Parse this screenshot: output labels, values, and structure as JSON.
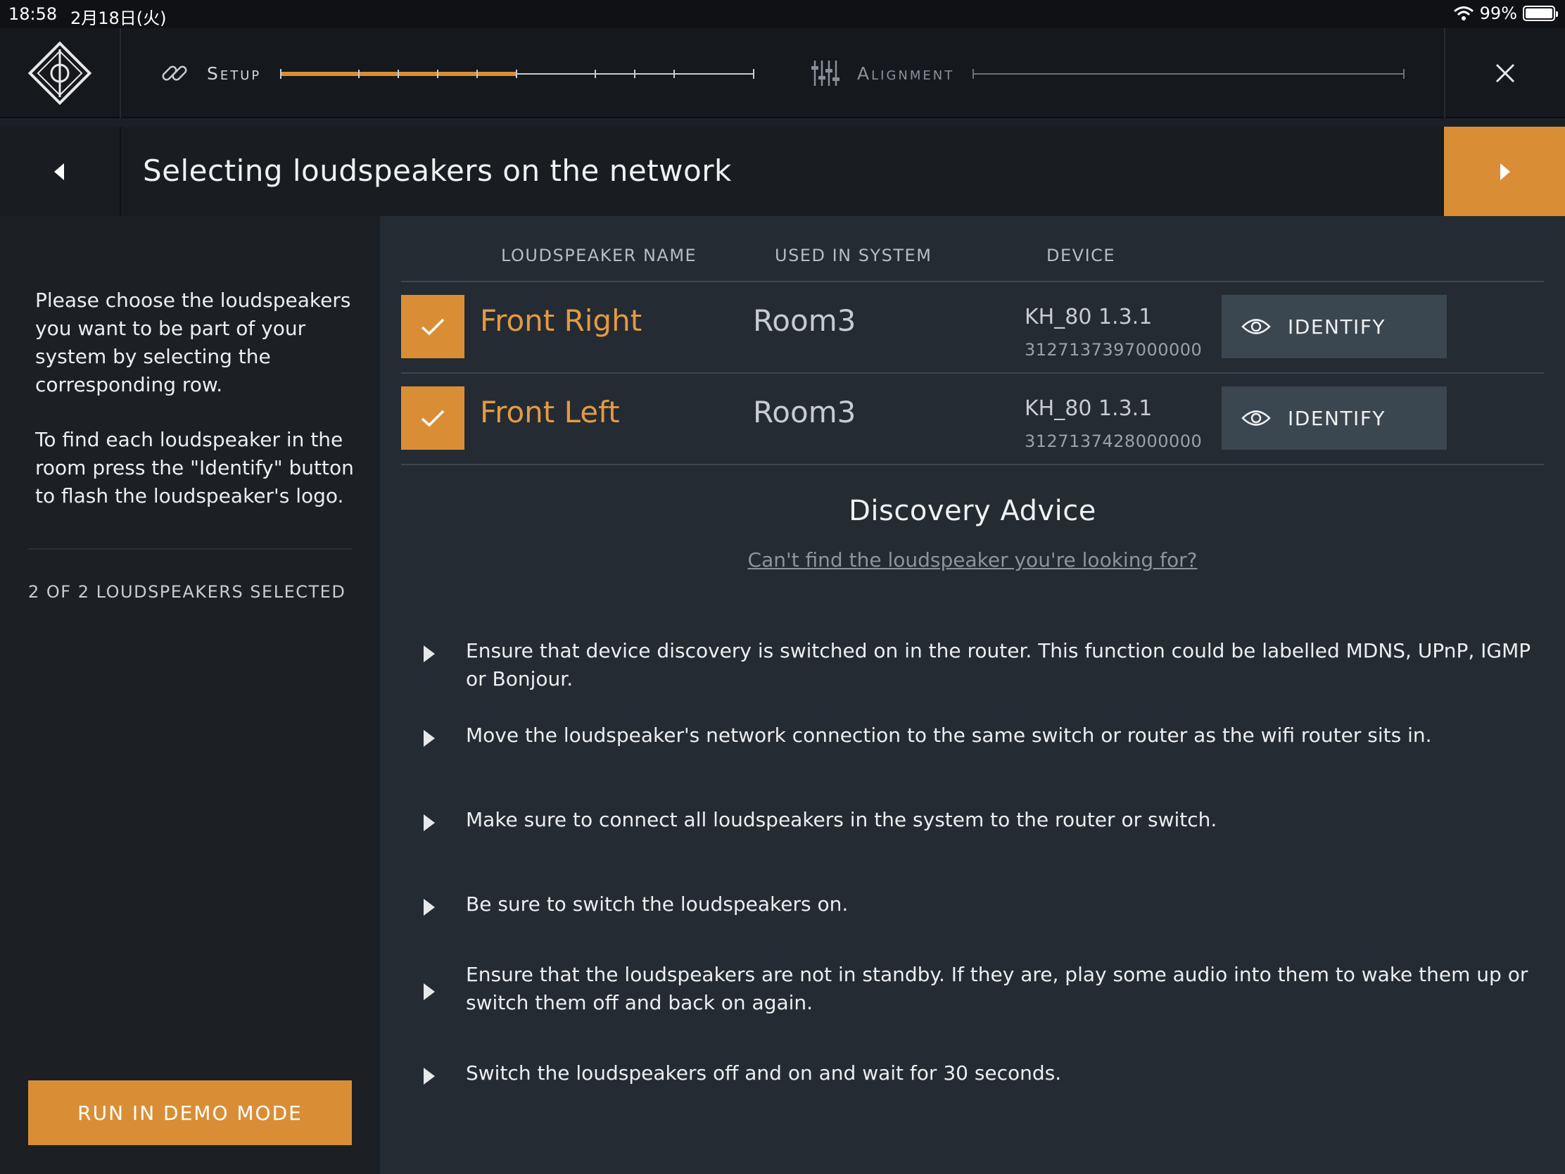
{
  "status": {
    "time": "18:58",
    "date": "2月18日(火)",
    "battery": "99%",
    "battery_level": 0.99
  },
  "nav": {
    "setup_label": "Setup",
    "alignment_label": "Alignment",
    "setup_progress": 0.5
  },
  "title": "Selecting loudspeakers on the network",
  "left": {
    "instruction_1": "Please choose the loudspeakers you want to be part of your system by selecting the corresponding row.",
    "instruction_2": "To find each loudspeaker in the room press the \"Identify\" button to flash the loudspeaker's logo.",
    "selected_count": "2 OF 2 LOUDSPEAKERS SELECTED",
    "demo_button": "RUN IN DEMO MODE"
  },
  "table": {
    "columns": [
      "LOUDSPEAKER NAME",
      "USED IN SYSTEM",
      "DEVICE"
    ],
    "rows": [
      {
        "name": "Front Right",
        "system": "Room3",
        "device": "KH_80 1.3.1",
        "serial": "3127137397000000",
        "identify": "IDENTIFY",
        "selected": true
      },
      {
        "name": "Front Left",
        "system": "Room3",
        "device": "KH_80 1.3.1",
        "serial": "3127137428000000",
        "identify": "IDENTIFY",
        "selected": true
      }
    ]
  },
  "advice": {
    "title": "Discovery Advice",
    "link": "Can't find the loudspeaker you're looking for?",
    "items": [
      "Ensure that device discovery is switched on in the router. This function could be labelled MDNS, UPnP, IGMP or Bonjour.",
      "Move the loudspeaker's network connection to the same switch or router as the wifi router sits in.",
      "Make sure to connect all loudspeakers in the system to the router or switch.",
      "Be sure to switch the loudspeakers on.",
      "Ensure that the loudspeakers are not in standby. If they are, play some audio into them to wake them up or switch them off and back on again.",
      "Switch the loudspeakers off and on and wait for 30 seconds."
    ]
  },
  "colors": {
    "accent": "#d98e36",
    "panel_dark": "#1c1f24",
    "panel_main": "#252b32",
    "identify_bg": "#3a4650"
  }
}
